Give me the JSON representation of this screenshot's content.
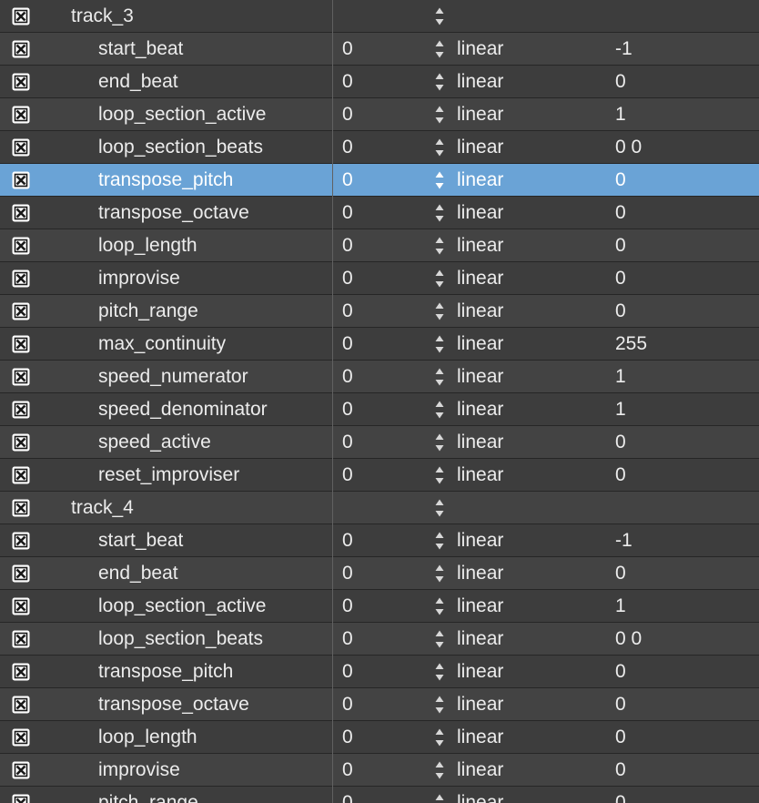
{
  "colors": {
    "row_even": "#3d3d3d",
    "row_odd": "#434343",
    "selected": "#6aa3d6",
    "text": "#ececec"
  },
  "icons": {
    "checkbox": "checkbox-checked-icon",
    "stepper": "stepper-arrows-icon"
  },
  "rows": [
    {
      "name": "track_3",
      "start": "",
      "interp": "",
      "end": "",
      "group": true,
      "checked": true
    },
    {
      "name": "start_beat",
      "start": "0",
      "interp": "linear",
      "end": "-1",
      "checked": true
    },
    {
      "name": "end_beat",
      "start": "0",
      "interp": "linear",
      "end": "0",
      "checked": true
    },
    {
      "name": "loop_section_active",
      "start": "0",
      "interp": "linear",
      "end": "1",
      "checked": true
    },
    {
      "name": "loop_section_beats",
      "start": "0",
      "interp": "linear",
      "end": "0 0",
      "checked": true
    },
    {
      "name": "transpose_pitch",
      "start": "0",
      "interp": "linear",
      "end": "0",
      "checked": true,
      "selected": true
    },
    {
      "name": "transpose_octave",
      "start": "0",
      "interp": "linear",
      "end": "0",
      "checked": true
    },
    {
      "name": "loop_length",
      "start": "0",
      "interp": "linear",
      "end": "0",
      "checked": true
    },
    {
      "name": "improvise",
      "start": "0",
      "interp": "linear",
      "end": "0",
      "checked": true
    },
    {
      "name": "pitch_range",
      "start": "0",
      "interp": "linear",
      "end": "0",
      "checked": true
    },
    {
      "name": "max_continuity",
      "start": "0",
      "interp": "linear",
      "end": "255",
      "checked": true
    },
    {
      "name": "speed_numerator",
      "start": "0",
      "interp": "linear",
      "end": "1",
      "checked": true
    },
    {
      "name": "speed_denominator",
      "start": "0",
      "interp": "linear",
      "end": "1",
      "checked": true
    },
    {
      "name": "speed_active",
      "start": "0",
      "interp": "linear",
      "end": "0",
      "checked": true
    },
    {
      "name": "reset_improviser",
      "start": "0",
      "interp": "linear",
      "end": "0",
      "checked": true
    },
    {
      "name": "track_4",
      "start": "",
      "interp": "",
      "end": "",
      "group": true,
      "checked": true
    },
    {
      "name": "start_beat",
      "start": "0",
      "interp": "linear",
      "end": "-1",
      "checked": true
    },
    {
      "name": "end_beat",
      "start": "0",
      "interp": "linear",
      "end": "0",
      "checked": true
    },
    {
      "name": "loop_section_active",
      "start": "0",
      "interp": "linear",
      "end": "1",
      "checked": true
    },
    {
      "name": "loop_section_beats",
      "start": "0",
      "interp": "linear",
      "end": "0 0",
      "checked": true
    },
    {
      "name": "transpose_pitch",
      "start": "0",
      "interp": "linear",
      "end": "0",
      "checked": true
    },
    {
      "name": "transpose_octave",
      "start": "0",
      "interp": "linear",
      "end": "0",
      "checked": true
    },
    {
      "name": "loop_length",
      "start": "0",
      "interp": "linear",
      "end": "0",
      "checked": true
    },
    {
      "name": "improvise",
      "start": "0",
      "interp": "linear",
      "end": "0",
      "checked": true
    },
    {
      "name": "pitch_range",
      "start": "0",
      "interp": "linear",
      "end": "0",
      "checked": true
    }
  ]
}
